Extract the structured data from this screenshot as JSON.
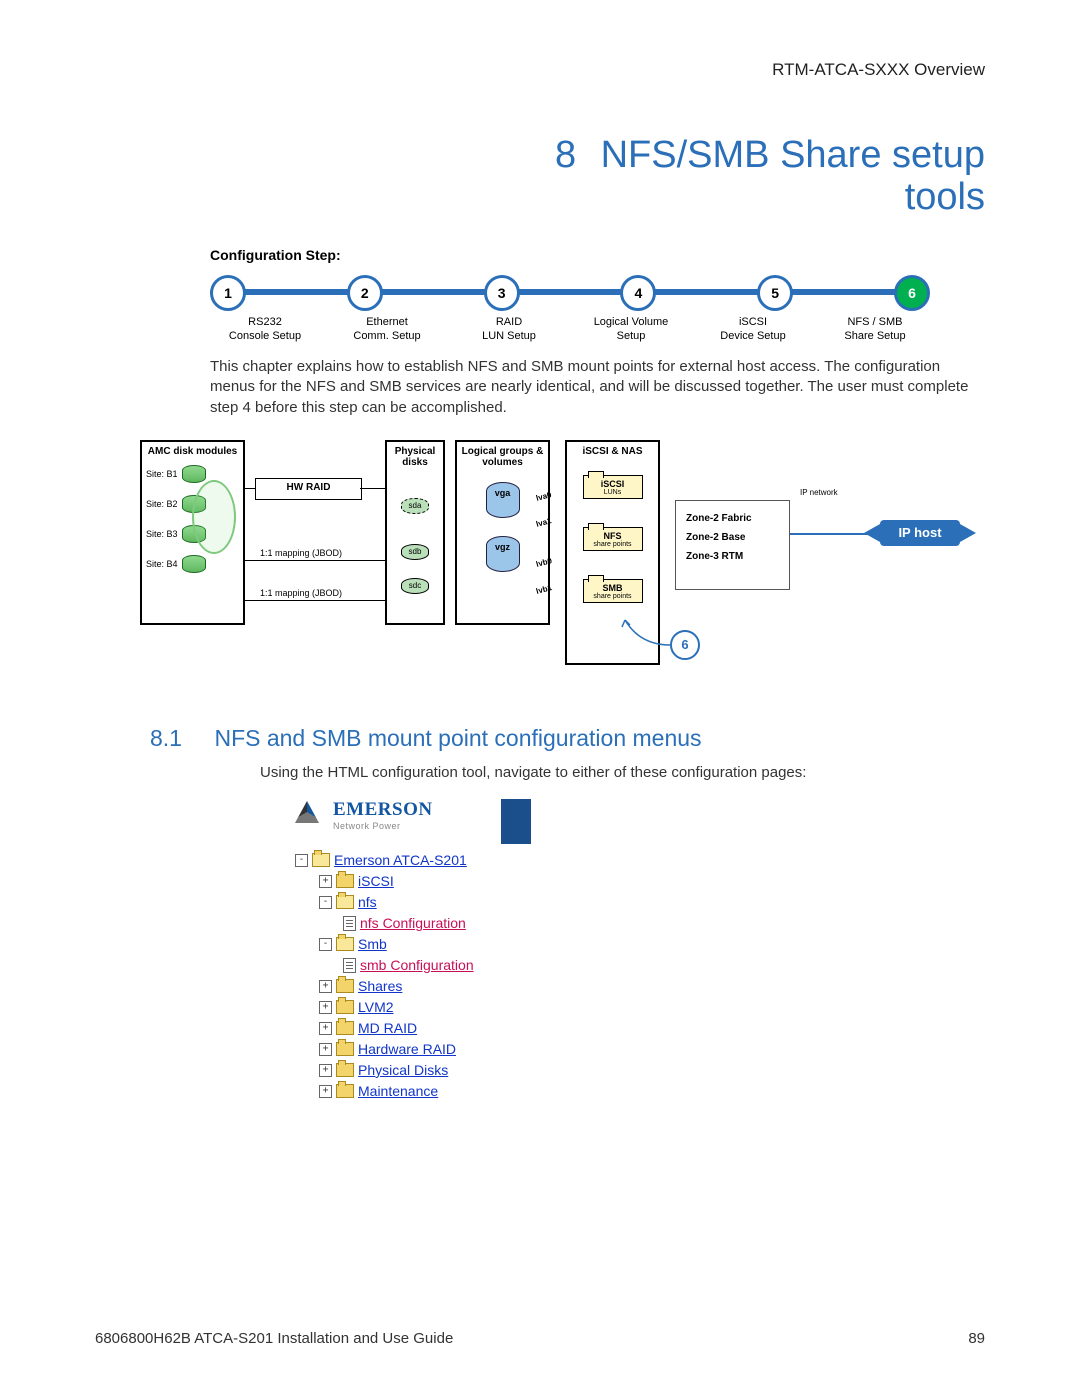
{
  "header": "RTM-ATCA-SXXX Overview",
  "chapter": {
    "num": "8",
    "title_l1": "NFS/SMB Share setup",
    "title_l2": "tools"
  },
  "conf_step_label": "Configuration Step:",
  "steps": [
    {
      "num": "1",
      "l1": "RS232",
      "l2": "Console Setup"
    },
    {
      "num": "2",
      "l1": "Ethernet",
      "l2": "Comm. Setup"
    },
    {
      "num": "3",
      "l1": "RAID",
      "l2": "LUN Setup"
    },
    {
      "num": "4",
      "l1": "Logical Volume",
      "l2": "Setup"
    },
    {
      "num": "5",
      "l1": "iSCSI",
      "l2": "Device Setup"
    },
    {
      "num": "6",
      "l1": "NFS / SMB",
      "l2": "Share Setup"
    }
  ],
  "body": {
    "p": "This chapter explains how to establish NFS and SMB mount points for external host access. The configuration menus for the NFS and SMB services are nearly identical, and will be discussed together.  The user must complete step 4 before this step can be accomplished."
  },
  "diagram": {
    "amc_title": "AMC disk modules",
    "sites": [
      "Site: B1",
      "Site: B2",
      "Site: B3",
      "Site: B4"
    ],
    "hwraid": "HW RAID",
    "map1": "1:1 mapping (JBOD)",
    "map2": "1:1 mapping (JBOD)",
    "phys_title": "Physical disks",
    "pdisks": [
      "sda",
      "sdb",
      "sdc"
    ],
    "log_title": "Logical groups & volumes",
    "vgs": [
      "vga",
      "vgz"
    ],
    "lvs": [
      "lva0",
      "lva1",
      "lvb0",
      "lvb1"
    ],
    "nas_title": "iSCSI & NAS",
    "iscsi_t": "iSCSI",
    "iscsi_s": "LUNs",
    "nfs_t": "NFS",
    "nfs_s": "share points",
    "smb_t": "SMB",
    "smb_s": "share points",
    "zone1": "Zone-2 Fabric",
    "zone2": "Zone-2 Base",
    "zone3": "Zone-3 RTM",
    "ipnet": "IP network",
    "iphost": "IP host",
    "step6": "6"
  },
  "section": {
    "num": "8.1",
    "title": "NFS and SMB mount point configuration menus",
    "body": "Using the HTML configuration tool, navigate to either of these configuration pages:"
  },
  "nav": {
    "brand": "EMERSON",
    "brand_sub": "Network Power",
    "root": "Emerson ATCA-S201",
    "iscsi": "iSCSI",
    "nfs": "nfs",
    "nfs_cfg": "nfs Configuration",
    "smb": "Smb",
    "smb_cfg": "smb Configuration",
    "shares": "Shares",
    "lvm2": "LVM2",
    "mdraid": "MD RAID",
    "hwraid": "Hardware RAID",
    "pdisks": "Physical Disks",
    "maint": "Maintenance"
  },
  "footer": {
    "left": "6806800H62B ATCA-S201 Installation and Use Guide",
    "right": "89"
  }
}
